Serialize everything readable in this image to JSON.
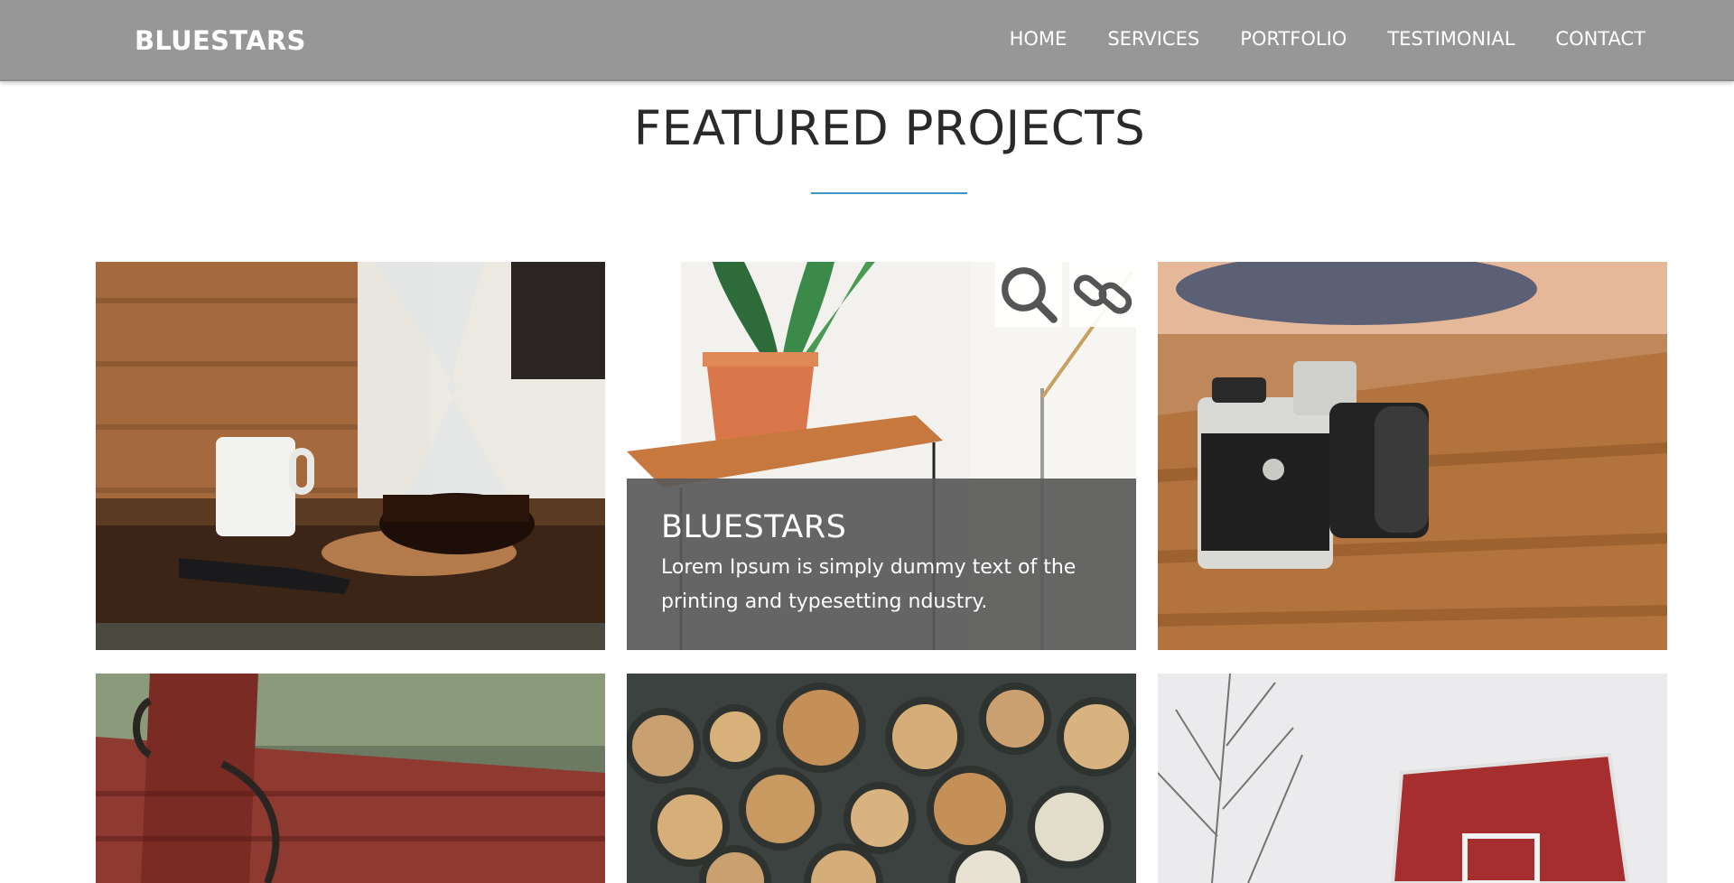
{
  "navbar": {
    "brand": "BLUESTARS",
    "links": [
      "HOME",
      "SERVICES",
      "PORTFOLIO",
      "TESTIMONIAL",
      "CONTACT"
    ]
  },
  "section": {
    "title": "FEATURED PROJECTS"
  },
  "featured_tile": {
    "caption_title": "BLUESTARS",
    "caption_text": "Lorem Ipsum is simply dummy text of the printing and typesetting ndustry.",
    "actions": [
      "search-icon",
      "link-icon"
    ]
  },
  "colors": {
    "navbar_bg": "#979797",
    "accent": "#3b97c3",
    "caption_bg": "#5a5a5a",
    "text_dark": "#2a2a2a"
  }
}
